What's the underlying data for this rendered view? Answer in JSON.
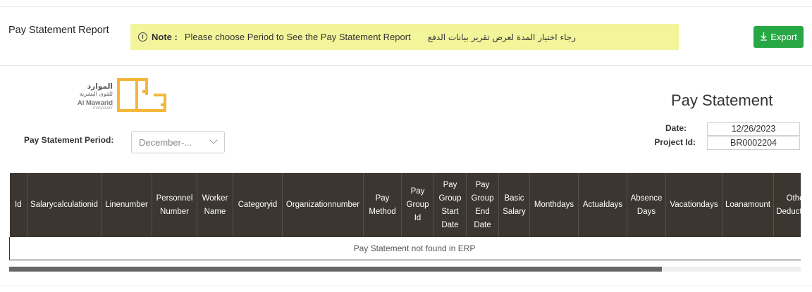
{
  "header": {
    "title": "Pay Statement Report",
    "note_label": "Note :",
    "note_message": "Please choose Period to See the Pay Statement Report",
    "note_message_ar": "رجاء اختيار المدة لعرض تقرير بيانات الدفع",
    "note_icon": "info-icon",
    "export_label": "Export",
    "export_icon": "download-icon"
  },
  "logo": {
    "text_ar": "الموارد",
    "text_ar_sub": "للقوى البشرية",
    "text_en": "Al Mawarid",
    "text_en_sub": "manpower",
    "color": "#f4b73a"
  },
  "document": {
    "title": "Pay Statement",
    "date_label": "Date:",
    "date_value": "12/26/2023",
    "project_label": "Project Id:",
    "project_value": "BR0002204"
  },
  "filter": {
    "period_label": "Pay Statement Period:",
    "period_value": "December-..."
  },
  "table": {
    "columns": [
      "Id",
      "Salarycalculationid",
      "Linenumber",
      "Personnel Number",
      "Worker Name",
      "Categoryid",
      "Organizationnumber",
      "Pay Method",
      "Pay Group Id",
      "Pay Group Start Date",
      "Pay Group End Date",
      "Basic Salary",
      "Monthdays",
      "Actualdays",
      "Absence Days",
      "Vacationdays",
      "Loanamount",
      "Other Deductions"
    ],
    "empty_message": "Pay Statement not found in ERP"
  },
  "scroll": {
    "position": 0.825
  },
  "colors": {
    "accent": "#28a745",
    "note_bg": "#f2f59a",
    "table_header": "#3b362f"
  }
}
